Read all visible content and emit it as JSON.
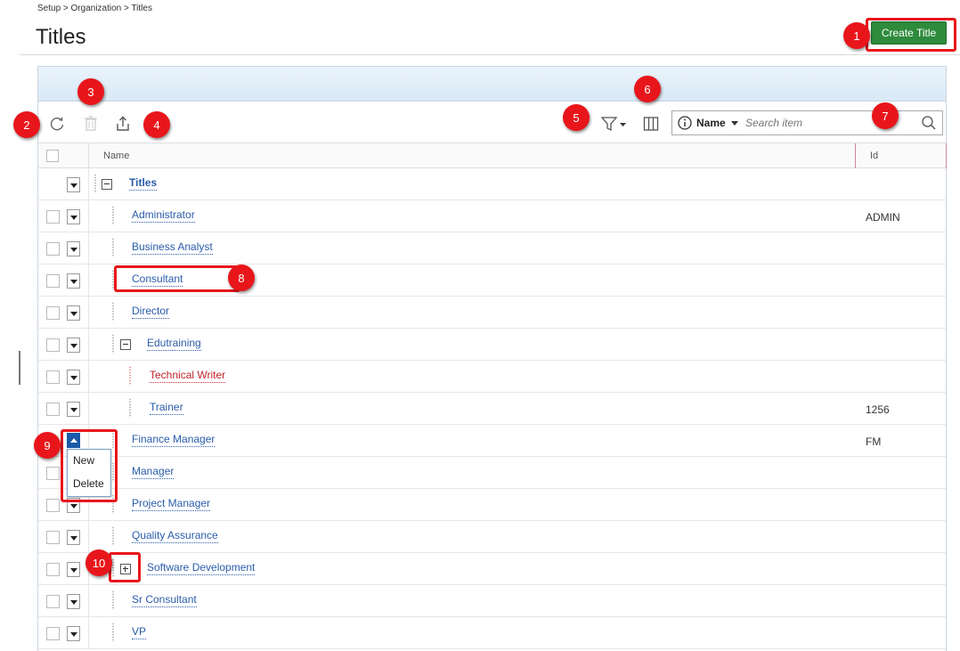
{
  "breadcrumb": "Setup > Organization > Titles",
  "page_title": "Titles",
  "create_button": "Create Title",
  "search": {
    "field": "Name",
    "placeholder": "Search item"
  },
  "columns": {
    "name": "Name",
    "id": "Id"
  },
  "rows": [
    {
      "label": "Titles",
      "id": "",
      "level": 0
    },
    {
      "label": "Administrator",
      "id": "ADMIN",
      "level": 1
    },
    {
      "label": "Business Analyst",
      "id": "",
      "level": 1
    },
    {
      "label": "Consultant",
      "id": "",
      "level": 1
    },
    {
      "label": "Director",
      "id": "",
      "level": 1
    },
    {
      "label": "Edutraining",
      "id": "",
      "level": 1
    },
    {
      "label": "Technical Writer",
      "id": "",
      "level": 2
    },
    {
      "label": "Trainer",
      "id": "1256",
      "level": 2
    },
    {
      "label": "Finance Manager",
      "id": "FM",
      "level": 1
    },
    {
      "label": "Manager",
      "id": "",
      "level": 1
    },
    {
      "label": "Project Manager",
      "id": "",
      "level": 1
    },
    {
      "label": "Quality Assurance",
      "id": "",
      "level": 1
    },
    {
      "label": "Software Development",
      "id": "",
      "level": 1
    },
    {
      "label": "Sr Consultant",
      "id": "",
      "level": 1
    },
    {
      "label": "VP",
      "id": "",
      "level": 1
    }
  ],
  "context_menu": [
    "New",
    "Delete"
  ],
  "badges": [
    "1",
    "2",
    "3",
    "4",
    "5",
    "6",
    "7",
    "8",
    "9",
    "10"
  ],
  "colors": {
    "accent": "#2e8b3c",
    "link": "#2a5caa",
    "callout": "#e8161b",
    "highlight_text": "#c0262c"
  }
}
